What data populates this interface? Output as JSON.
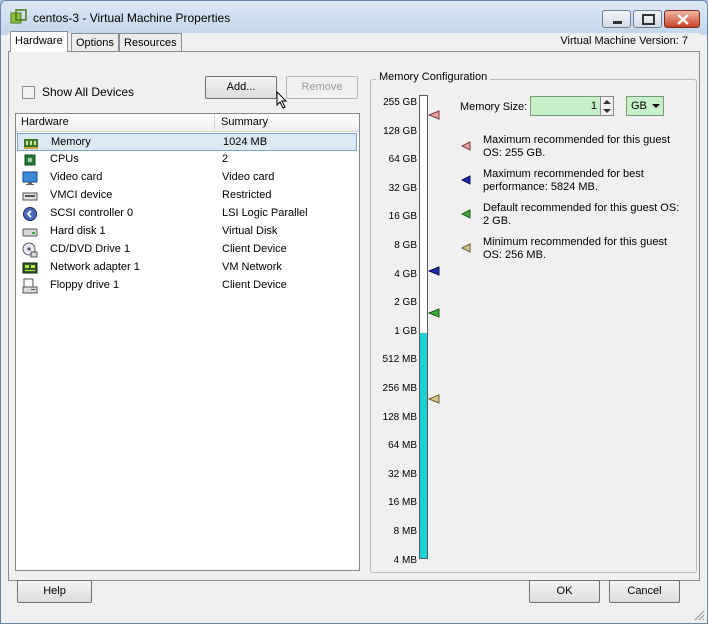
{
  "window": {
    "title": "centos-3 - Virtual Machine Properties"
  },
  "tabs": [
    {
      "label": "Hardware"
    },
    {
      "label": "Options"
    },
    {
      "label": "Resources"
    }
  ],
  "version_label": "Virtual Machine Version: 7",
  "hardware": {
    "show_all_label": "Show All Devices",
    "add_label": "Add...",
    "remove_label": "Remove",
    "columns": [
      "Hardware",
      "Summary"
    ],
    "devices": [
      {
        "name": "Memory",
        "summary": "1024 MB",
        "icon": "memory-icon"
      },
      {
        "name": "CPUs",
        "summary": "2",
        "icon": "cpu-icon"
      },
      {
        "name": "Video card",
        "summary": "Video card",
        "icon": "video-card-icon"
      },
      {
        "name": "VMCI device",
        "summary": "Restricted",
        "icon": "vmci-icon"
      },
      {
        "name": "SCSI controller 0",
        "summary": "LSI Logic Parallel",
        "icon": "scsi-controller-icon"
      },
      {
        "name": "Hard disk 1",
        "summary": "Virtual Disk",
        "icon": "hard-disk-icon"
      },
      {
        "name": "CD/DVD Drive 1",
        "summary": "Client Device",
        "icon": "cd-dvd-icon"
      },
      {
        "name": "Network adapter 1",
        "summary": "VM Network",
        "icon": "network-adapter-icon"
      },
      {
        "name": "Floppy drive 1",
        "summary": "Client Device",
        "icon": "floppy-drive-icon"
      }
    ]
  },
  "memory_config": {
    "group_title": "Memory Configuration",
    "scale_labels": [
      "255 GB",
      "128 GB",
      "64 GB",
      "32 GB",
      "16 GB",
      "8 GB",
      "4 GB",
      "2 GB",
      "1 GB",
      "512 MB",
      "256 MB",
      "128 MB",
      "64 MB",
      "32 MB",
      "16 MB",
      "8 MB",
      "4 MB"
    ],
    "current_value_label": "1 GB",
    "memory_size_label": "Memory Size:",
    "memory_size_value": "1",
    "unit": "GB",
    "legend": [
      {
        "text": "Maximum recommended for this guest OS: 255 GB.",
        "color": "#e8a0a0",
        "icon": "max-guest-marker-icon",
        "scale": "255 GB"
      },
      {
        "text": "Maximum recommended for best performance: 5824 MB.",
        "color": "#1a2aa8",
        "icon": "best-performance-marker-icon",
        "scale": "5824 MB"
      },
      {
        "text": "Default recommended for this guest OS: 2 GB.",
        "color": "#3aa83a",
        "icon": "default-marker-icon",
        "scale": "2 GB"
      },
      {
        "text": "Minimum recommended for this guest OS: 256 MB.",
        "color": "#d8c890",
        "icon": "min-guest-marker-icon",
        "scale": "256 MB"
      }
    ],
    "fill_color": "#1ed0d4"
  },
  "footer": {
    "help_label": "Help",
    "ok_label": "OK",
    "cancel_label": "Cancel"
  }
}
